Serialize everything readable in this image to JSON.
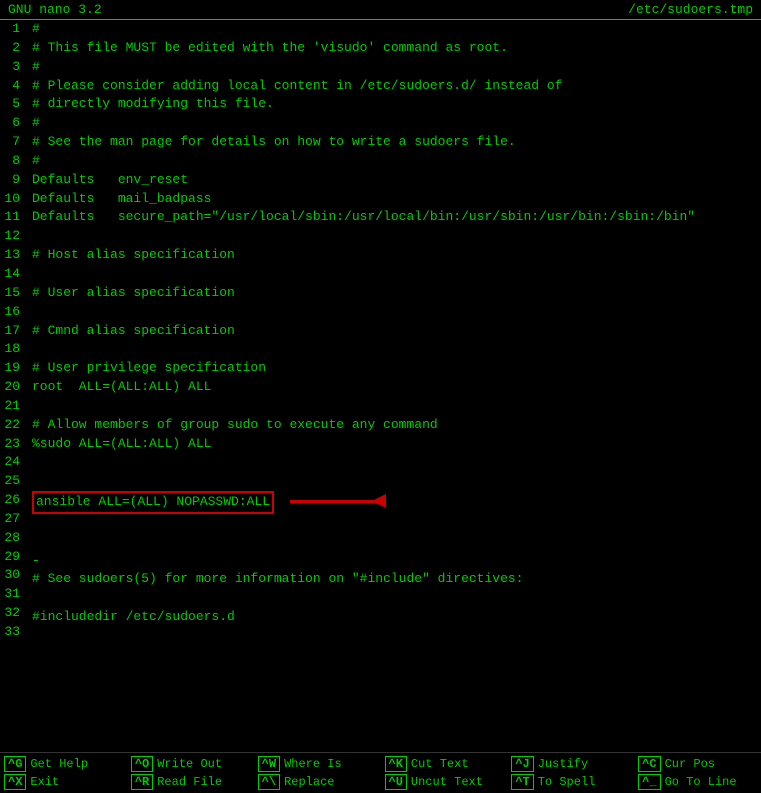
{
  "title_bar": {
    "left": "GNU nano 3.2",
    "right": "/etc/sudoers.tmp"
  },
  "lines": [
    {
      "num": "1",
      "text": "#"
    },
    {
      "num": "2",
      "text": "# This file MUST be edited with the 'visudo' command as root."
    },
    {
      "num": "3",
      "text": "#"
    },
    {
      "num": "4",
      "text": "# Please consider adding local content in /etc/sudoers.d/ instead of"
    },
    {
      "num": "5",
      "text": "# directly modifying this file."
    },
    {
      "num": "6",
      "text": "#"
    },
    {
      "num": "7",
      "text": "# See the man page for details on how to write a sudoers file."
    },
    {
      "num": "8",
      "text": "#"
    },
    {
      "num": "9",
      "text": "Defaults   env_reset"
    },
    {
      "num": "10",
      "text": "Defaults   mail_badpass"
    },
    {
      "num": "11",
      "text": "Defaults   secure_path=\"/usr/local/sbin:/usr/local/bin:/usr/sbin:/usr/bin:/sbin:/bin\""
    },
    {
      "num": "12",
      "text": ""
    },
    {
      "num": "13",
      "text": "# Host alias specification"
    },
    {
      "num": "14",
      "text": ""
    },
    {
      "num": "15",
      "text": "# User alias specification"
    },
    {
      "num": "16",
      "text": ""
    },
    {
      "num": "17",
      "text": "# Cmnd alias specification"
    },
    {
      "num": "18",
      "text": ""
    },
    {
      "num": "19",
      "text": "# User privilege specification"
    },
    {
      "num": "20",
      "text": "root  ALL=(ALL:ALL) ALL"
    },
    {
      "num": "21",
      "text": ""
    },
    {
      "num": "22",
      "text": "# Allow members of group sudo to execute any command"
    },
    {
      "num": "23",
      "text": "%sudo ALL=(ALL:ALL) ALL"
    },
    {
      "num": "24",
      "text": ""
    },
    {
      "num": "25",
      "text": ""
    },
    {
      "num": "26",
      "text": "ansible ALL=(ALL) NOPASSWD:ALL",
      "highlighted": true
    },
    {
      "num": "27",
      "text": ""
    },
    {
      "num": "28",
      "text": ""
    },
    {
      "num": "29",
      "text": "-"
    },
    {
      "num": "30",
      "text": "# See sudoers(5) for more information on \"#include\" directives:"
    },
    {
      "num": "31",
      "text": ""
    },
    {
      "num": "32",
      "text": "#includedir /etc/sudoers.d"
    },
    {
      "num": "33",
      "text": ""
    }
  ],
  "shortcuts": {
    "row1": [
      {
        "key": "^G",
        "label": "Get Help"
      },
      {
        "key": "^O",
        "label": "Write Out"
      },
      {
        "key": "^W",
        "label": "Where Is"
      },
      {
        "key": "^K",
        "label": "Cut Text"
      },
      {
        "key": "^J",
        "label": "Justify"
      },
      {
        "key": "^C",
        "label": "Cur Pos"
      }
    ],
    "row2": [
      {
        "key": "^X",
        "label": "Exit"
      },
      {
        "key": "^R",
        "label": "Read File"
      },
      {
        "key": "^\\",
        "label": "Replace"
      },
      {
        "key": "^U",
        "label": "Uncut Text"
      },
      {
        "key": "^T",
        "label": "To Spell"
      },
      {
        "key": "^_",
        "label": "Go To Line"
      }
    ]
  }
}
